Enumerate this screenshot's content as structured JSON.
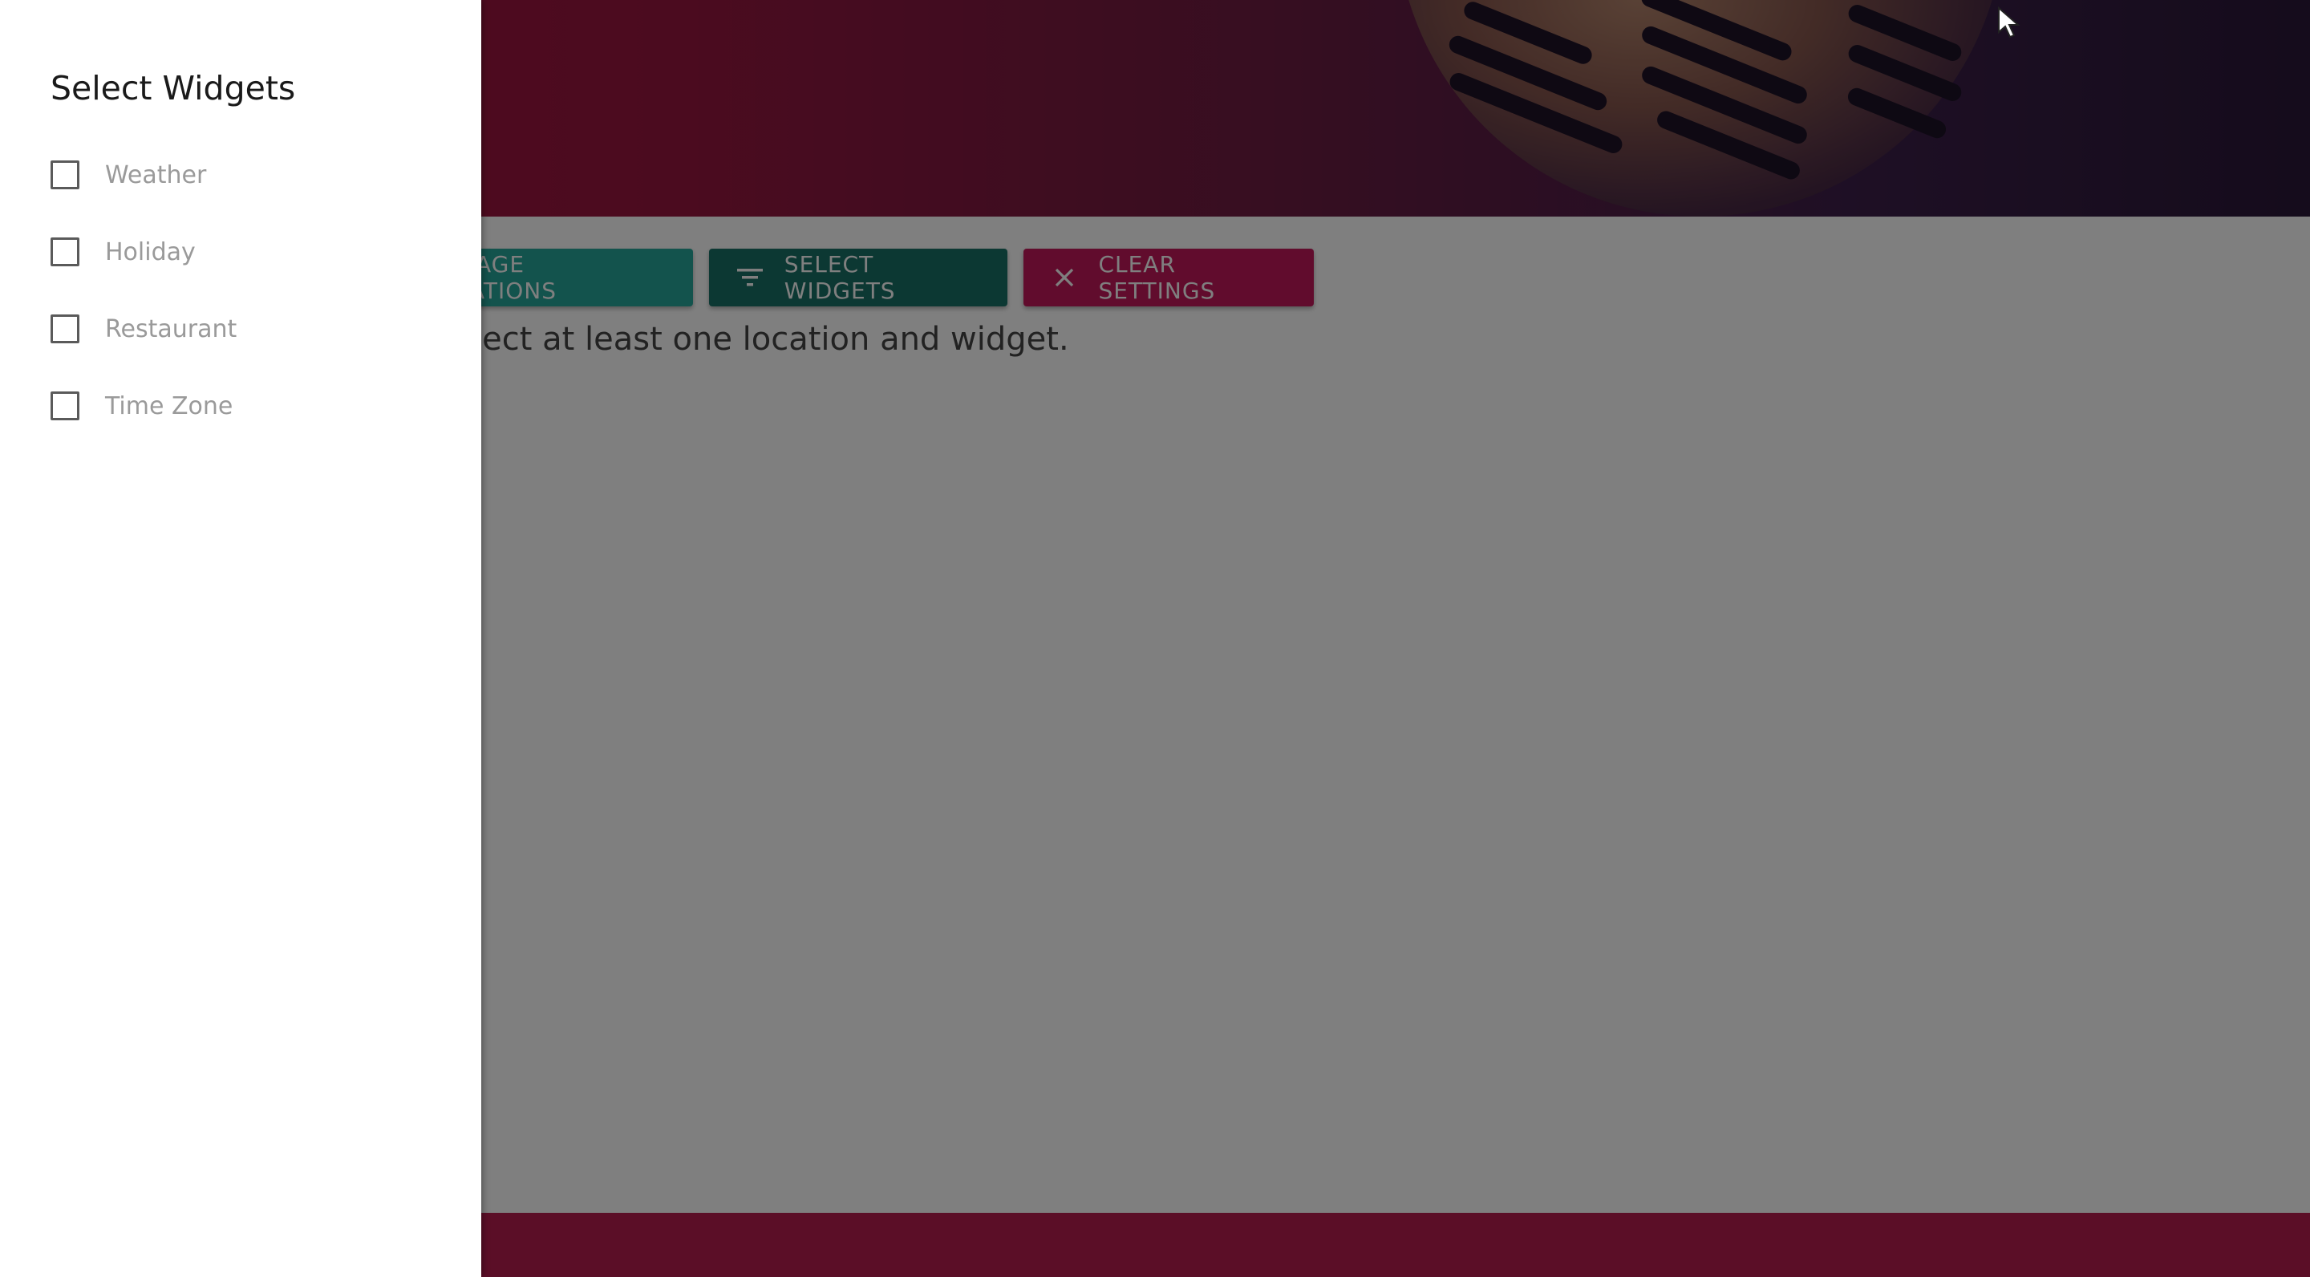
{
  "header": {
    "banner_image": "vintage-microphone"
  },
  "toolbar": {
    "manage_locations_label": "MANAGE LOCATIONS",
    "manage_locations_icon": "location-icon",
    "select_widgets_label": "SELECT WIDGETS",
    "select_widgets_icon": "filter-icon",
    "clear_settings_label": "CLEAR SETTINGS",
    "clear_settings_icon": "close-icon"
  },
  "main": {
    "hint": "Select at least one location and widget."
  },
  "drawer": {
    "title": "Select Widgets",
    "options": [
      {
        "label": "Weather",
        "checked": false
      },
      {
        "label": "Holiday",
        "checked": false
      },
      {
        "label": "Restaurant",
        "checked": false
      },
      {
        "label": "Time Zone",
        "checked": false
      }
    ]
  },
  "colors": {
    "header_start": "#a8103f",
    "header_end": "#2a1838",
    "teal": "#26a69a",
    "dark_teal": "#187066",
    "pink": "#c2185b",
    "footer": "#b71d4f"
  }
}
